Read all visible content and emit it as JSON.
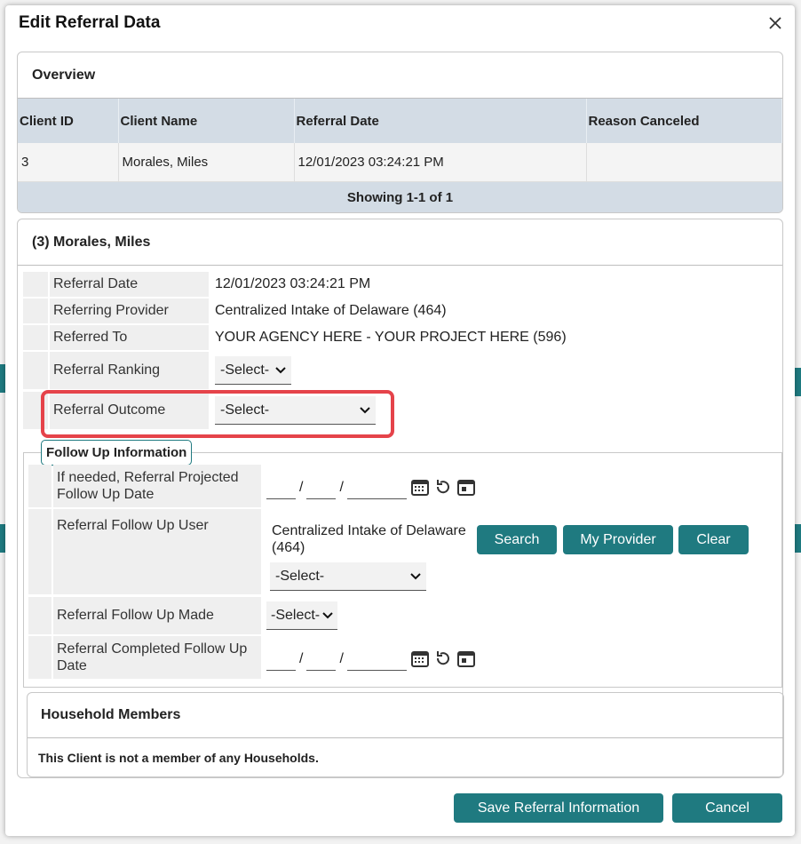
{
  "modal": {
    "title": "Edit Referral Data"
  },
  "overview": {
    "title": "Overview",
    "columns": [
      "Client ID",
      "Client Name",
      "Referral Date",
      "Reason Canceled"
    ],
    "rows": [
      [
        "3",
        "Morales, Miles",
        "12/01/2023 03:24:21 PM",
        ""
      ]
    ],
    "footer": "Showing 1-1 of 1"
  },
  "client": {
    "header": "(3) Morales, Miles",
    "referral_date_label": "Referral Date",
    "referral_date_value": "12/01/2023 03:24:21 PM",
    "referring_provider_label": "Referring Provider",
    "referring_provider_value": "Centralized Intake of Delaware (464)",
    "referred_to_label": "Referred To",
    "referred_to_value": "YOUR AGENCY HERE - YOUR PROJECT HERE (596)",
    "referral_ranking_label": "Referral Ranking",
    "referral_ranking_value": "-Select-",
    "referral_outcome_label": "Referral Outcome",
    "referral_outcome_value": "-Select-"
  },
  "follow_up": {
    "legend": "Follow Up Information",
    "projected_label": "If needed, Referral Projected Follow Up Date",
    "user_label": "Referral Follow Up User",
    "user_value": "Centralized Intake of Delaware (464)",
    "user_select": "-Select-",
    "search_button": "Search",
    "my_provider_button": "My Provider",
    "clear_button": "Clear",
    "made_label": "Referral Follow Up Made",
    "made_value": "-Select-",
    "completed_label": "Referral Completed Follow Up Date",
    "date_separator": "/"
  },
  "household": {
    "title": "Household Members",
    "message": "This Client is not a member of any Households."
  },
  "footer": {
    "save_button": "Save Referral Information",
    "cancel_button": "Cancel"
  },
  "colors": {
    "accent": "#1f7a80",
    "highlight": "#e5434a",
    "table_header": "#d3dce5"
  },
  "icons": [
    "close-icon",
    "calendar-icon",
    "reset-icon",
    "today-icon",
    "chevron-down-icon"
  ]
}
